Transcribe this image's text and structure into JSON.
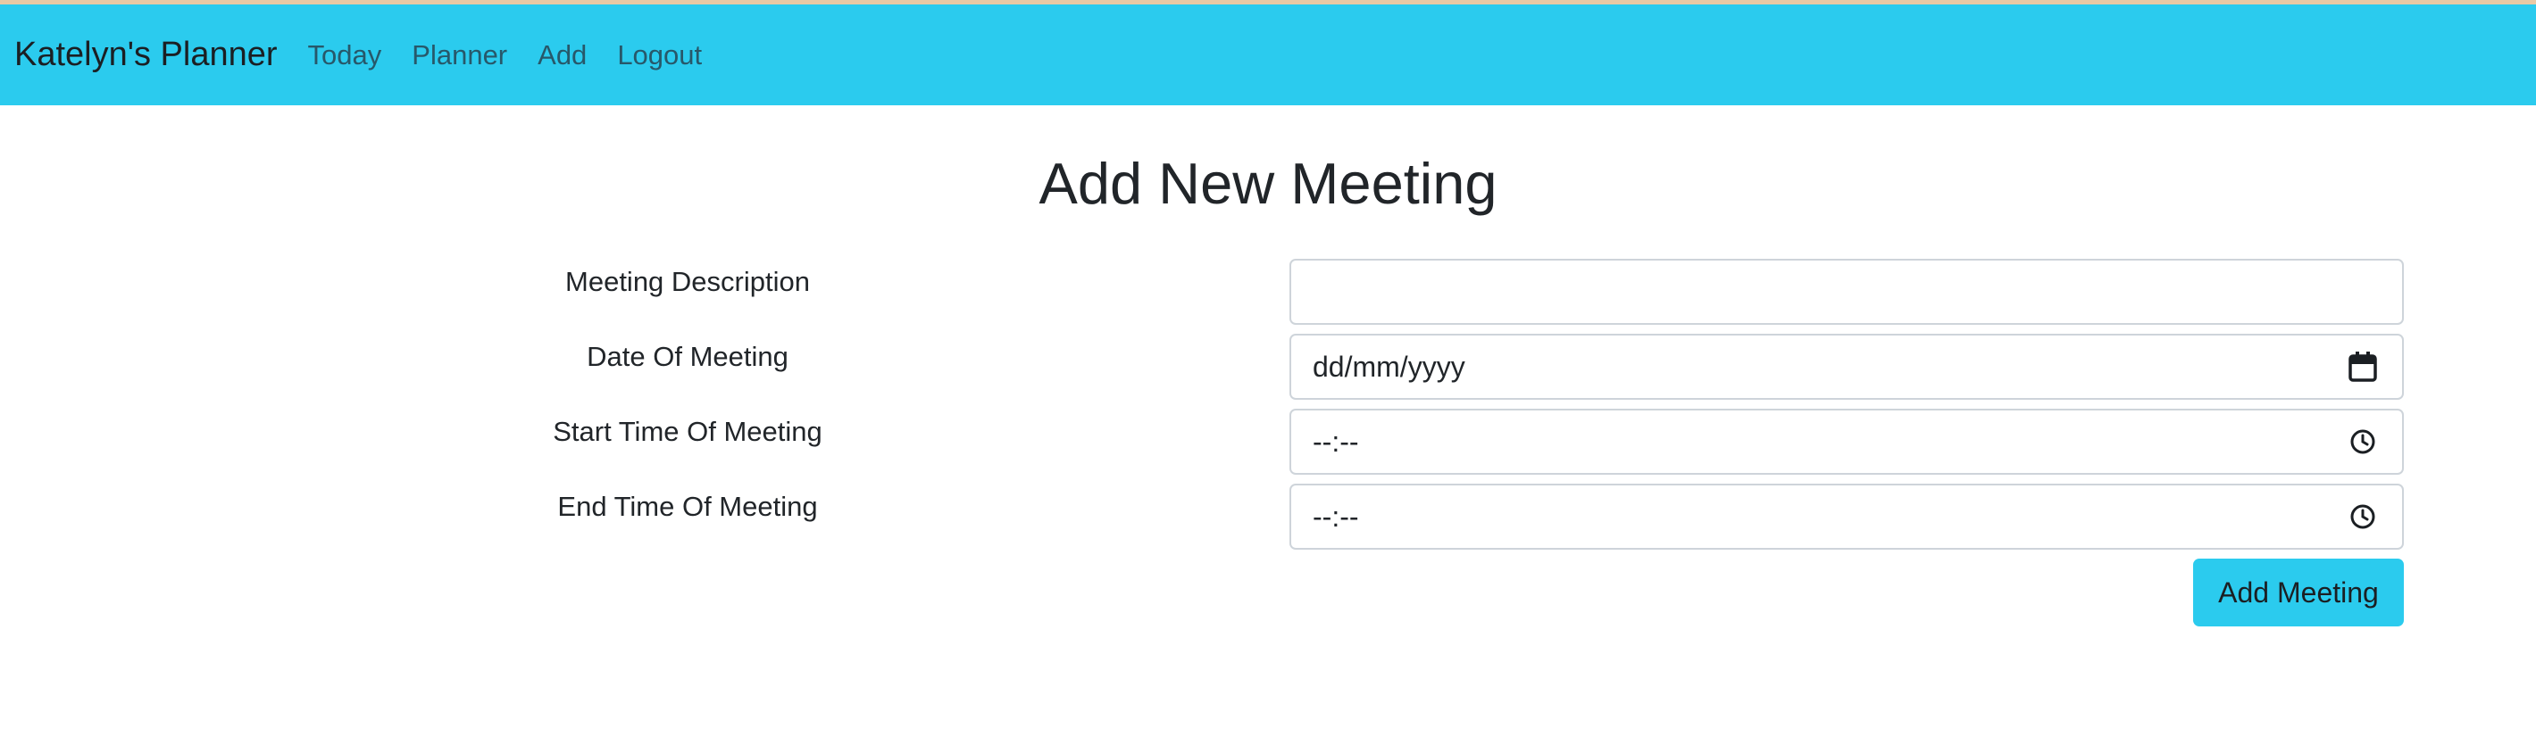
{
  "navbar": {
    "brand": "Katelyn's Planner",
    "links": [
      "Today",
      "Planner",
      "Add",
      "Logout"
    ],
    "background": "#2bcbee"
  },
  "page": {
    "title": "Add New Meeting"
  },
  "form": {
    "description": {
      "label": "Meeting Description",
      "value": ""
    },
    "date": {
      "label": "Date Of Meeting",
      "value": "dd/mm/yyyy",
      "icon": "calendar-icon"
    },
    "start_time": {
      "label": "Start Time Of Meeting",
      "value": "--:--",
      "icon": "clock-icon"
    },
    "end_time": {
      "label": "End Time Of Meeting",
      "value": "--:--",
      "icon": "clock-icon"
    },
    "submit_label": "Add Meeting"
  }
}
